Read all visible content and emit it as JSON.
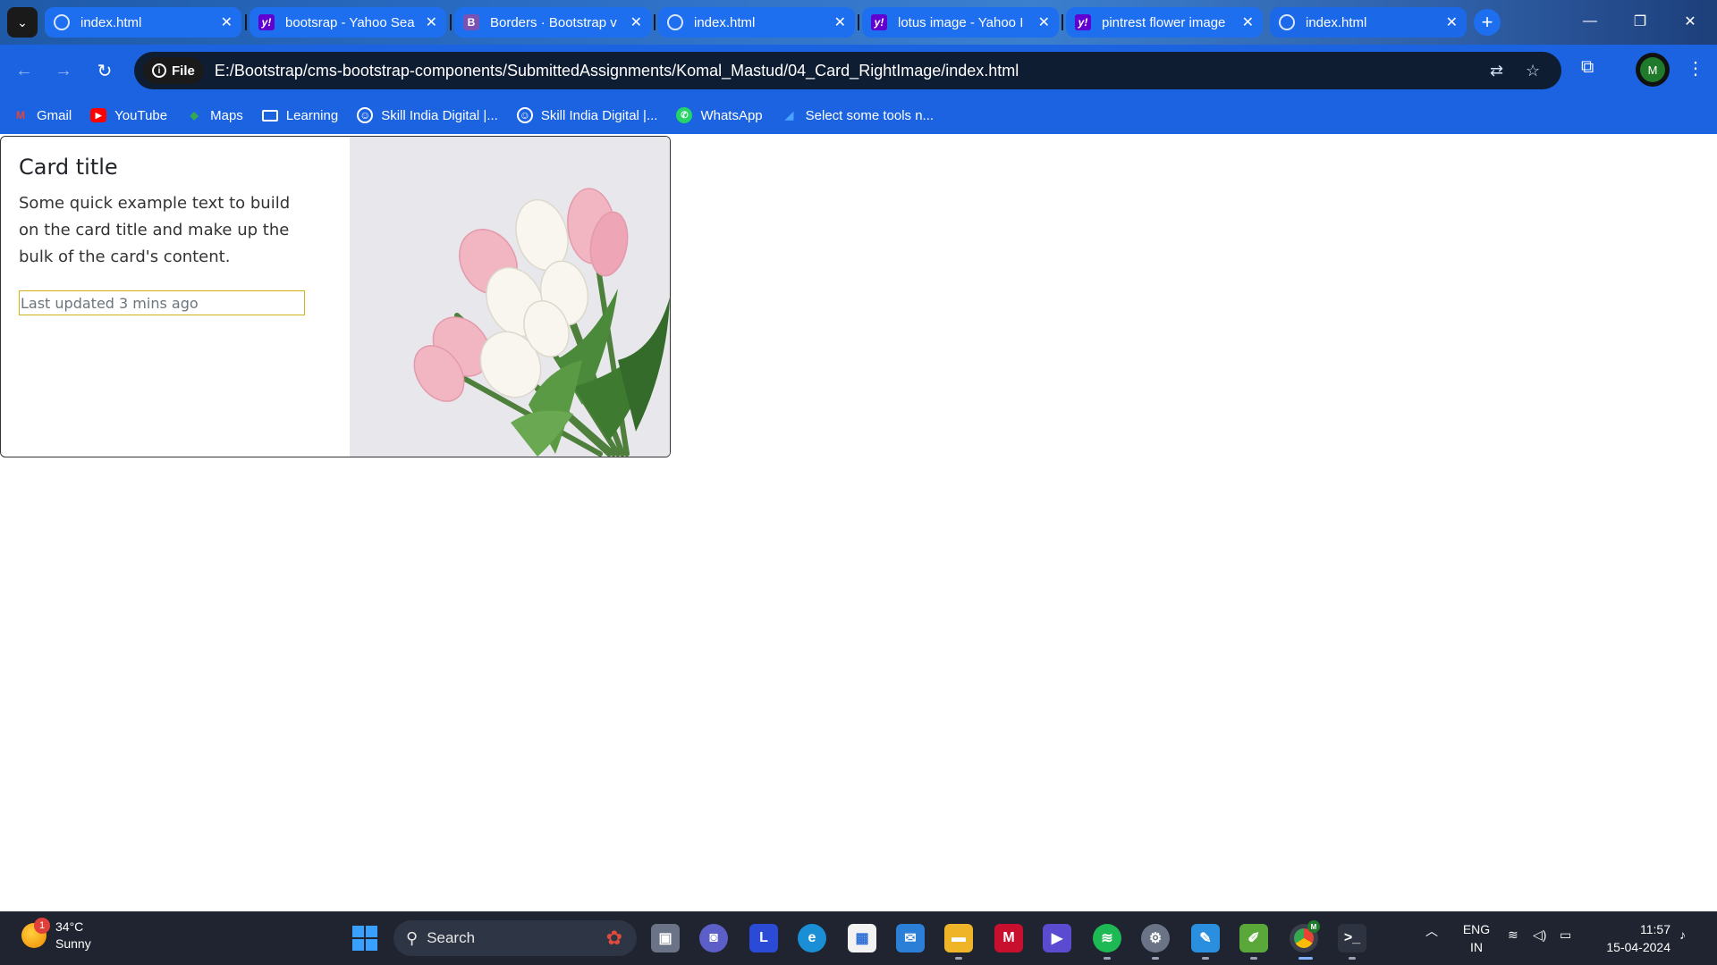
{
  "browser": {
    "tabs": [
      {
        "label": "index.html",
        "icon": "globe-icon"
      },
      {
        "label": "bootsrap - Yahoo Sea",
        "icon": "yahoo-icon"
      },
      {
        "label": "Borders · Bootstrap v",
        "icon": "bootstrap-icon"
      },
      {
        "label": "index.html",
        "icon": "globe-icon"
      },
      {
        "label": "lotus image - Yahoo I",
        "icon": "yahoo-icon"
      },
      {
        "label": "pintrest flower image",
        "icon": "yahoo-icon"
      },
      {
        "label": "index.html",
        "icon": "globe-icon",
        "active": true
      }
    ],
    "tab_close_glyph": "✕",
    "new_tab_glyph": "+",
    "address": {
      "chip_label": "File",
      "url": "E:/Bootstrap/cms-bootstrap-components/SubmittedAssignments/Komal_Mastud/04_Card_RightImage/index.html"
    },
    "profile_initial": "M",
    "bookmarks": [
      {
        "label": "Gmail",
        "icon": "gmail-icon"
      },
      {
        "label": "YouTube",
        "icon": "youtube-icon"
      },
      {
        "label": "Maps",
        "icon": "maps-icon"
      },
      {
        "label": "Learning",
        "icon": "folder-icon"
      },
      {
        "label": "Skill India Digital |...",
        "icon": "skill-india-icon"
      },
      {
        "label": "Skill India Digital |...",
        "icon": "skill-india-icon"
      },
      {
        "label": "WhatsApp",
        "icon": "whatsapp-icon"
      },
      {
        "label": "Select some tools n...",
        "icon": "tools-icon"
      }
    ]
  },
  "card": {
    "title": "Card title",
    "text": "Some quick example text to build on the card title and make up the bulk of the card's content.",
    "updated": "Last updated 3 mins ago",
    "image_alt": "pink and white tulips bouquet"
  },
  "taskbar": {
    "weather": {
      "temp": "34°C",
      "condition": "Sunny",
      "badge": "1"
    },
    "search_placeholder": "Search",
    "language": {
      "line1": "ENG",
      "line2": "IN"
    },
    "clock": {
      "time": "11:57",
      "date": "15-04-2024"
    },
    "profile_badge": "M"
  }
}
